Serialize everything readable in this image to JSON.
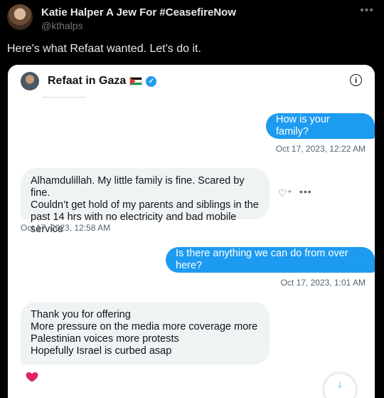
{
  "tweet": {
    "author_name": "Katie Halper A Jew For #CeasefireNow",
    "handle": "@kthalps",
    "more_icon": "ellipsis-icon",
    "text": "Here's what Refaat wanted. Let's do it."
  },
  "conversation": {
    "name": "Refaat in Gaza",
    "flag_icon": "palestine-flag-icon",
    "verified_icon": "verified-badge-icon",
    "info_icon": "info-icon",
    "messages": [
      {
        "dir": "out",
        "lines": [
          "How is your family?"
        ],
        "time": "Oct 17, 2023, 12:22 AM"
      },
      {
        "dir": "in",
        "lines": [
          "Alhamdulillah. My little family is fine. Scared by fine.",
          "Couldn’t get hold of my parents and siblings in the",
          "past 14 hrs with no electricity and bad mobile service"
        ],
        "time": "Oct 17, 2023, 12:58 AM"
      },
      {
        "dir": "out",
        "lines": [
          "Is there anything we can do from over here?"
        ],
        "time": "Oct 17, 2023, 1:01 AM"
      },
      {
        "dir": "in",
        "lines": [
          "Thank you for offering",
          "More pressure on the media more coverage more",
          "Palestinian voices more protests",
          "Hopefully Israel is curbed asap"
        ],
        "time": ""
      }
    ],
    "reaction": "heart-icon",
    "scroll_icon": "arrow-down-icon"
  },
  "colors": {
    "accent": "#1d9bf0",
    "background": "#000000",
    "bubble_in": "#eff3f4",
    "heart": "#f91880"
  }
}
